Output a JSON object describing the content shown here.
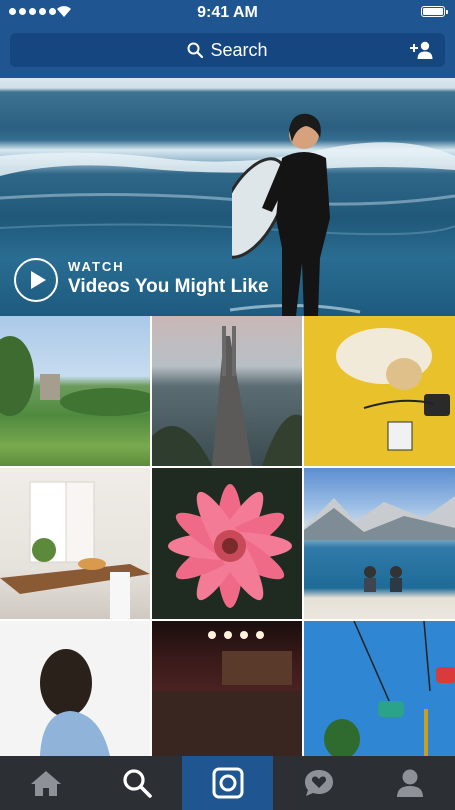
{
  "status_bar": {
    "time": "9:41 AM"
  },
  "search": {
    "placeholder": "Search"
  },
  "hero": {
    "kicker": "WATCH",
    "title": "Videos You Might Like"
  },
  "grid": {
    "tiles": [
      "park-photo",
      "bay-bridge-photo",
      "cat-photo",
      "dining-room-photo",
      "pink-flower-photo",
      "lake-mountains-photo",
      "woman-portrait-photo",
      "concert-photo",
      "ride-photo"
    ]
  },
  "tabs": [
    {
      "name": "home",
      "icon": "home-icon"
    },
    {
      "name": "search",
      "icon": "search-icon"
    },
    {
      "name": "camera",
      "icon": "camera-icon",
      "active": true
    },
    {
      "name": "activity",
      "icon": "heart-bubble-icon"
    },
    {
      "name": "profile",
      "icon": "person-icon"
    }
  ],
  "colors": {
    "brand_blue": "#1f5591",
    "search_field": "#154680",
    "tabbar": "#2c2f34"
  }
}
